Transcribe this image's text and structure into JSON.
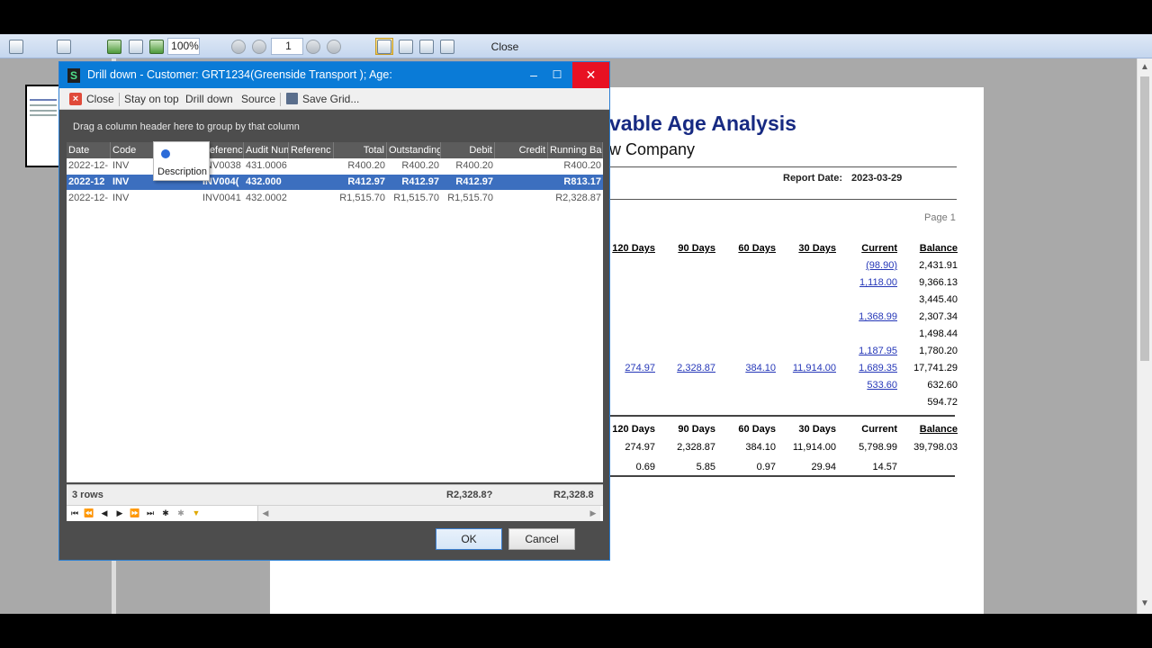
{
  "toolbar": {
    "zoom": "100%",
    "page_number": "1",
    "close_label": "Close"
  },
  "report": {
    "title": "vable Age Analysis",
    "company": "w Company",
    "report_date_label": "Report Date:",
    "report_date": "2023-03-29",
    "page_label": "Page 1",
    "columns": [
      "120 Days",
      "90 Days",
      "60 Days",
      "30 Days",
      "Current",
      "Balance"
    ],
    "rows": [
      [
        "",
        "",
        "",
        "",
        "(98.90)",
        "2,431.91"
      ],
      [
        "",
        "",
        "",
        "",
        "1,118.00",
        "9,366.13"
      ],
      [
        "",
        "",
        "",
        "",
        "",
        "3,445.40"
      ],
      [
        "",
        "",
        "",
        "",
        "1,368.99",
        "2,307.34"
      ],
      [
        "",
        "",
        "",
        "",
        "",
        "1,498.44"
      ],
      [
        "",
        "",
        "",
        "",
        "1,187.95",
        "1,780.20"
      ],
      [
        "274.97",
        "2,328.87",
        "384.10",
        "11,914.00",
        "1,689.35",
        "17,741.29"
      ],
      [
        "",
        "",
        "",
        "",
        "533.60",
        "632.60"
      ],
      [
        "",
        "",
        "",
        "",
        "",
        "594.72"
      ]
    ],
    "totals_headers": [
      "120 Days",
      "90 Days",
      "60 Days",
      "30 Days",
      "Current",
      "Balance"
    ],
    "totals": [
      "274.97",
      "2,328.87",
      "384.10",
      "11,914.00",
      "5,798.99",
      "39,798.03"
    ],
    "percentages": [
      "0.69",
      "5.85",
      "0.97",
      "29.94",
      "14.57",
      ""
    ]
  },
  "dialog": {
    "title": "Drill down - Customer: GRT1234(Greenside Transport ); Age:",
    "toolbar": {
      "close": "Close",
      "stay_on_top": "Stay on top",
      "drill_down": "Drill down",
      "source": "Source",
      "save_grid": "Save Grid..."
    },
    "group_hint": "Drag a column header here to group by that column",
    "columns": [
      "Date",
      "Code",
      "",
      "Referenc",
      "Audit Num",
      "Referenc",
      "Total",
      "Outstanding",
      "Debit",
      "Credit",
      "Running Ba"
    ],
    "rows": [
      [
        "2022-12-",
        "INV",
        "",
        "INV0038",
        "431.0006",
        "",
        "R400.20",
        "R400.20",
        "R400.20",
        "",
        "R400.20"
      ],
      [
        "2022-12",
        "INV",
        "",
        "INV004(",
        "432.000",
        "",
        "R412.97",
        "R412.97",
        "R412.97",
        "",
        "R813.17"
      ],
      [
        "2022-12-",
        "INV",
        "",
        "INV0041",
        "432.0002",
        "",
        "R1,515.70",
        "R1,515.70",
        "R1,515.70",
        "",
        "R2,328.87"
      ]
    ],
    "tooltip": "Description",
    "footer": {
      "row_count": "3 rows",
      "outstanding_total": "R2,328.8?",
      "running_total": "R2,328.8"
    },
    "ok": "OK",
    "cancel": "Cancel"
  }
}
